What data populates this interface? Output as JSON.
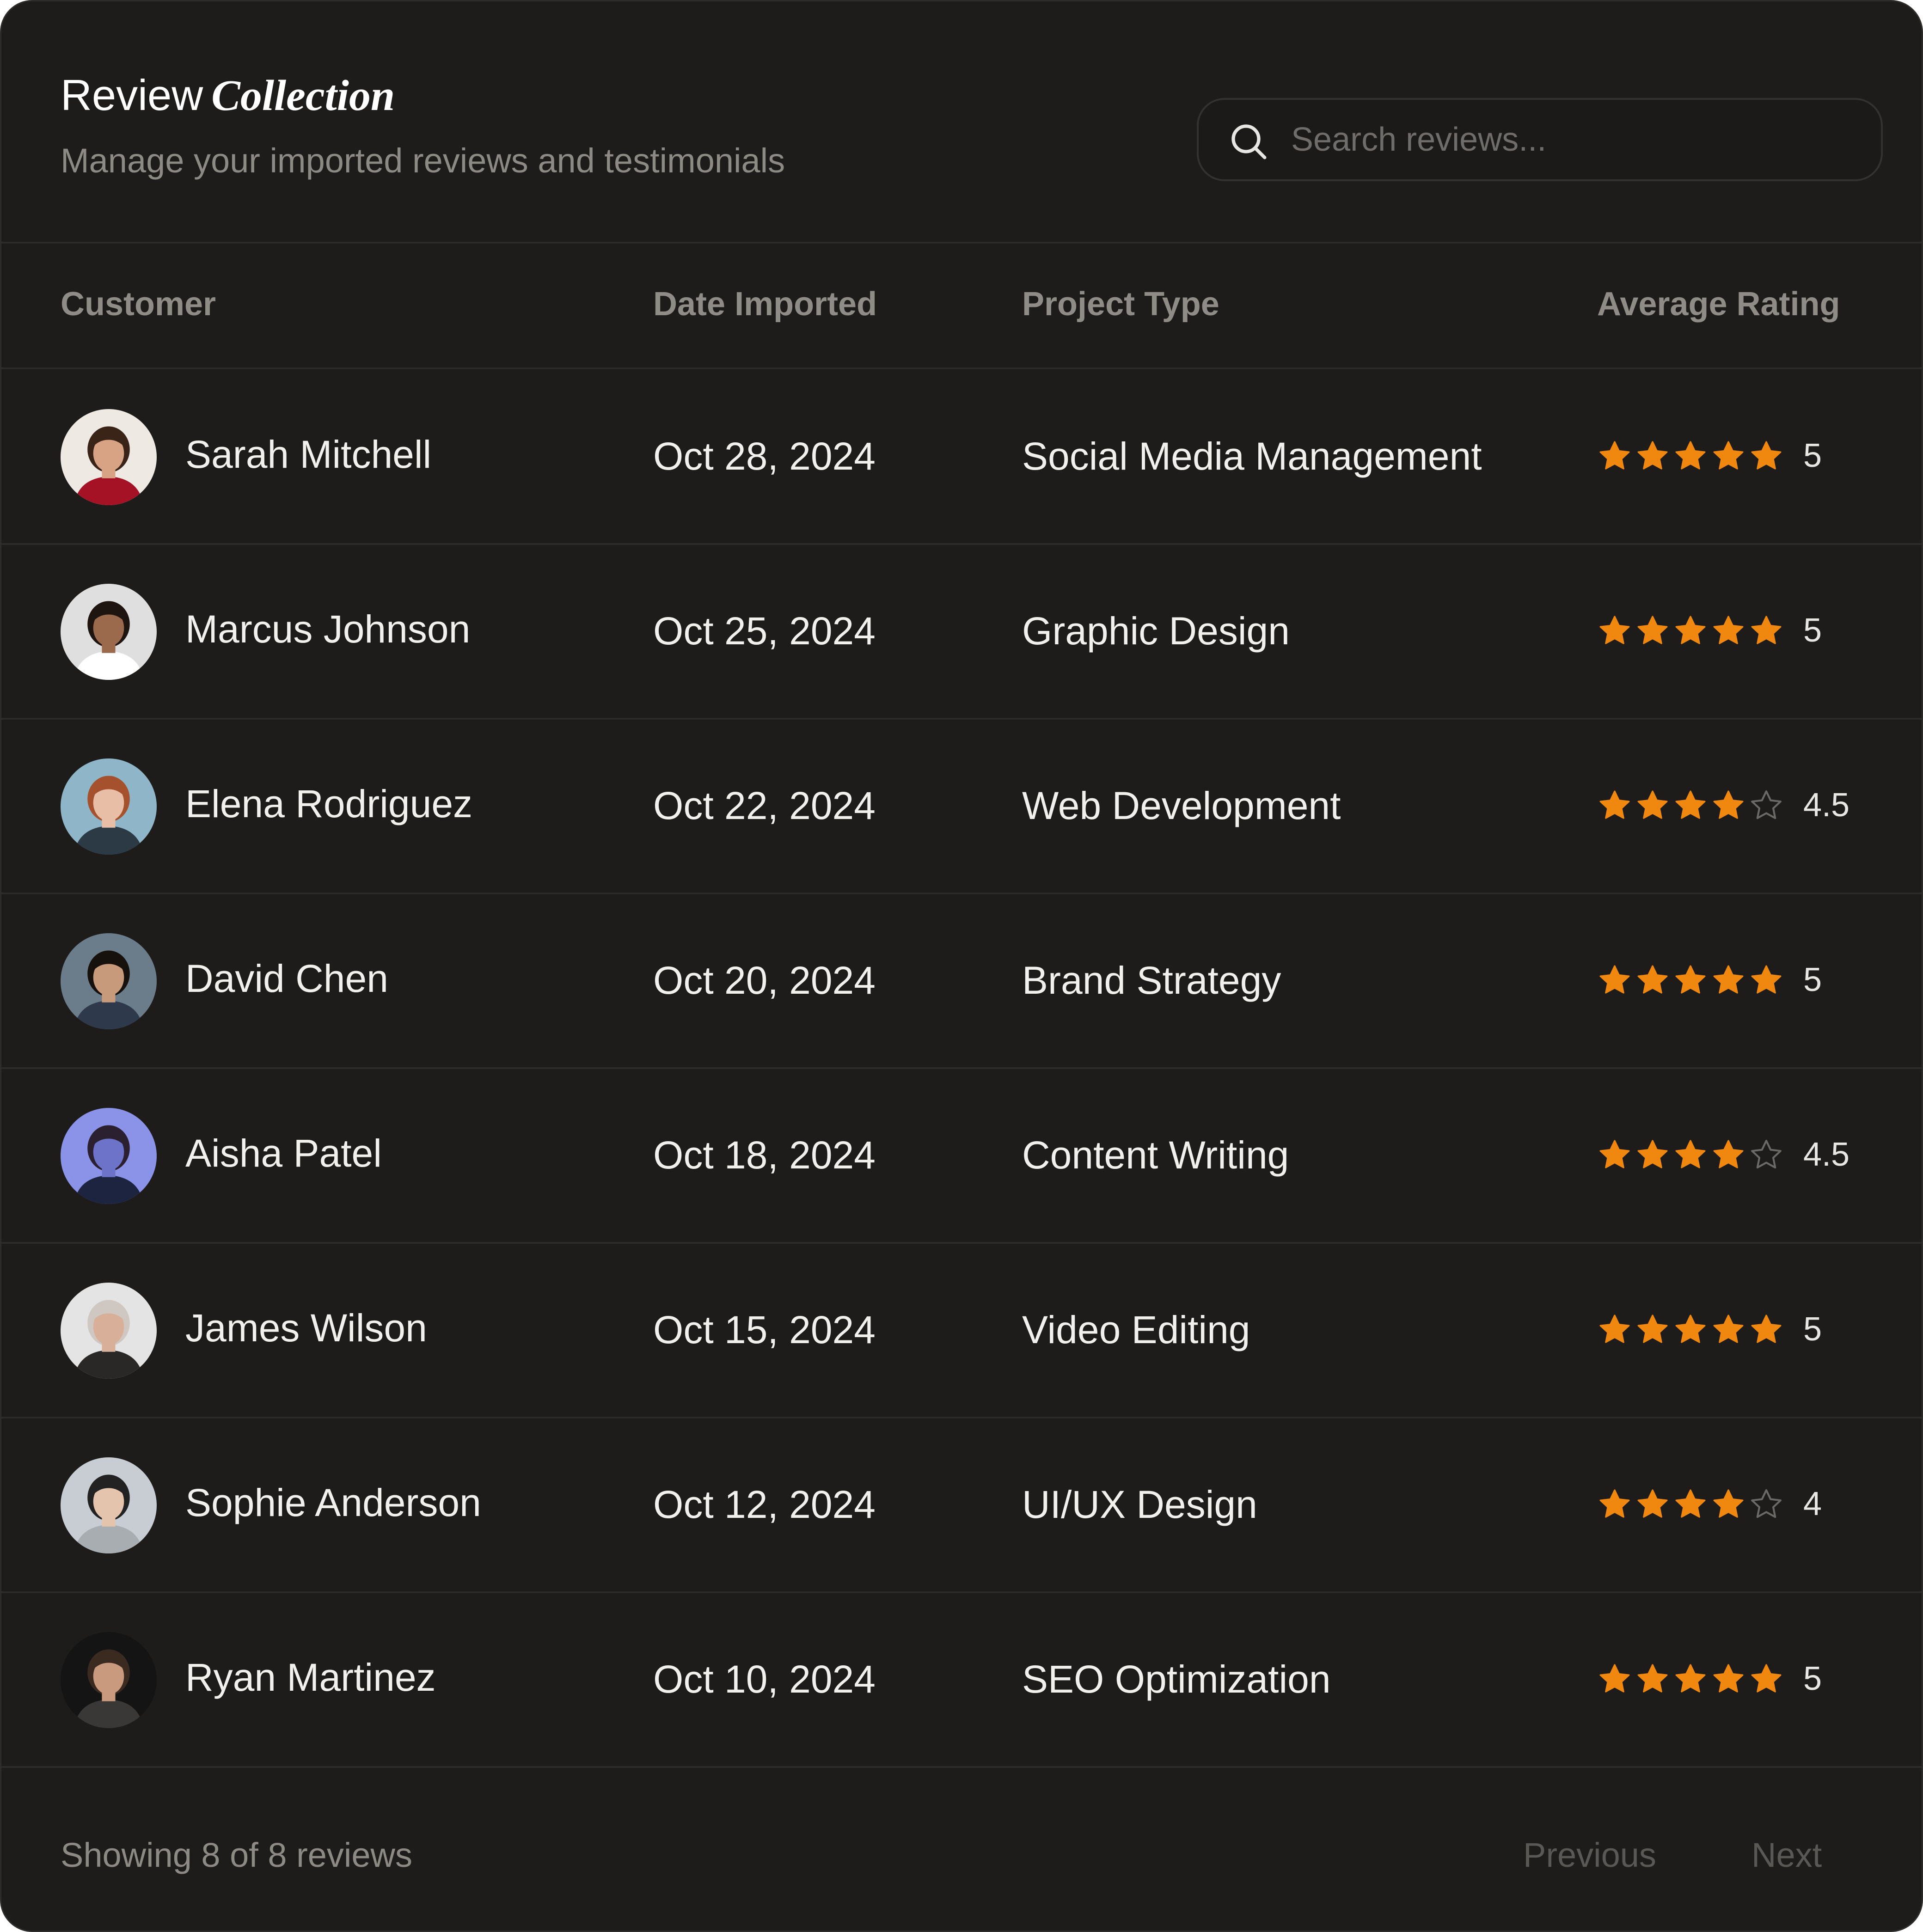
{
  "header": {
    "title_regular": "Review",
    "title_italic": "Collection",
    "subtitle": "Manage your imported reviews and testimonials"
  },
  "search": {
    "placeholder": "Search reviews...",
    "value": "",
    "icon": "search-icon"
  },
  "table": {
    "columns": [
      "Customer",
      "Date Imported",
      "Project Type",
      "Average Rating"
    ],
    "rows": [
      {
        "customer": "Sarah Mitchell",
        "date": "Oct 28, 2024",
        "project": "Social Media Management",
        "rating": 5,
        "rating_label": "5",
        "filled_stars": 5
      },
      {
        "customer": "Marcus Johnson",
        "date": "Oct 25, 2024",
        "project": "Graphic Design",
        "rating": 5,
        "rating_label": "5",
        "filled_stars": 5
      },
      {
        "customer": "Elena Rodriguez",
        "date": "Oct 22, 2024",
        "project": "Web Development",
        "rating": 4.5,
        "rating_label": "4.5",
        "filled_stars": 4
      },
      {
        "customer": "David Chen",
        "date": "Oct 20, 2024",
        "project": "Brand Strategy",
        "rating": 5,
        "rating_label": "5",
        "filled_stars": 5
      },
      {
        "customer": "Aisha Patel",
        "date": "Oct 18, 2024",
        "project": "Content Writing",
        "rating": 4.5,
        "rating_label": "4.5",
        "filled_stars": 4
      },
      {
        "customer": "James Wilson",
        "date": "Oct 15, 2024",
        "project": "Video Editing",
        "rating": 5,
        "rating_label": "5",
        "filled_stars": 5
      },
      {
        "customer": "Sophie Anderson",
        "date": "Oct 12, 2024",
        "project": "UI/UX Design",
        "rating": 4,
        "rating_label": "4",
        "filled_stars": 4
      },
      {
        "customer": "Ryan Martinez",
        "date": "Oct 10, 2024",
        "project": "SEO Optimization",
        "rating": 5,
        "rating_label": "5",
        "filled_stars": 5
      }
    ]
  },
  "footer": {
    "showing": "Showing 8 of 8 reviews",
    "previous": "Previous",
    "next": "Next"
  },
  "colors": {
    "background": "#1d1c1b",
    "star_filled": "#f0870f",
    "star_empty": "#6b6966",
    "text_primary": "#f2f0ed",
    "text_muted": "#8d8a86",
    "button_disabled": "#5a5855"
  }
}
